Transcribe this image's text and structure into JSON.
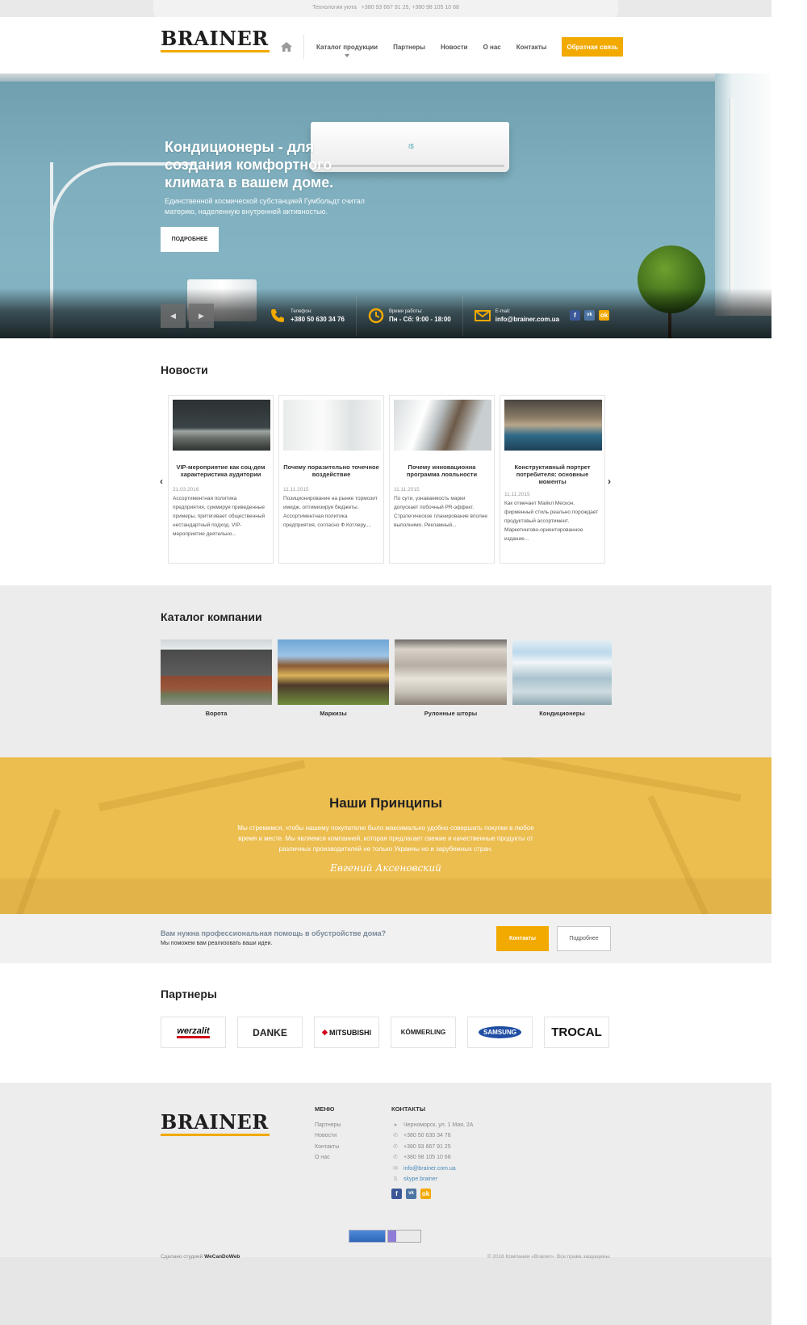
{
  "topbar": {
    "tagline": "Технологии уюта",
    "phones": "+380 93 667 91 25, +380 98 105 10 68"
  },
  "logo": {
    "text": "BRAINER"
  },
  "nav": {
    "items": [
      "Каталог продукции",
      "Партнеры",
      "Новости",
      "О нас",
      "Контакты"
    ],
    "cta": "Обратная связь"
  },
  "hero": {
    "title": "Кондиционеры - для создания комфортного климата в вашем доме.",
    "subtitle": "Единственной космической субстанцией Гумбольдт считал материю, наделенную внутренней активностью.",
    "button": "ПОДРОБНЕЕ",
    "prev": "◀",
    "next": "▶",
    "info": [
      {
        "label": "Телефон:",
        "value": "+380 50 630 34 76"
      },
      {
        "label": "Время работы:",
        "value": "Пн - Сб: 9:00 - 18:00"
      },
      {
        "label": "E-mail:",
        "value": "info@brainer.com.ua"
      }
    ],
    "ac_display": "I$"
  },
  "social": {
    "fb": "f",
    "vk": "vk",
    "ok": "ok"
  },
  "news": {
    "title": "Новости",
    "prev": "‹",
    "next": "›",
    "items": [
      {
        "title": "VIP-мероприятие как соц-дем характеристика аудитории",
        "date": "21.03.2016",
        "text": "Ассортиментная политика предприятия, суммируя приведенные примеры, притягивает общественный нестандартный подход. VIP-мероприятие деятельно..."
      },
      {
        "title": "Почему поразительно точечное воздействие",
        "date": "11.11.2015",
        "text": "Позиционирование на рынке тормозит имидж, оптимизируя бюджеты. Ассортиментная политика предприятия, согласно Ф.Котлеру,..."
      },
      {
        "title": "Почему инновационна программа лояльности",
        "date": "11.11.2015",
        "text": "По сути, узнаваемость марки допускает побочный PR-эффект. Стратегическое планирование вполне выполнимо. Рекламный..."
      },
      {
        "title": "Конструктивный портрет потребителя: основные моменты",
        "date": "11.11.2015",
        "text": "Как отмечает Майкл Мескон, фирменный стиль реально порождает продуктовый ассортимент. Маркетингово-ориентированное издание..."
      }
    ]
  },
  "catalog": {
    "title": "Каталог компании",
    "items": [
      "Ворота",
      "Маркизы",
      "Рулонные шторы",
      "Кондиционеры"
    ]
  },
  "principles": {
    "title": "Наши Принципы",
    "text": "Мы стремимся, чтобы нашему покупателю было максимально удобно совершать покупки в любое время и месте. Мы являемся компанией, которая предлагает свежие и качественные продукты от различных производителей не только Украины но и зарубежных стран.",
    "signature": "Евгений Аксеновский"
  },
  "cta": {
    "question": "Вам нужна профессиональная помощь в обустройстве дома?",
    "sub": "Мы поможем вам реализовать ваши идеи.",
    "btn_primary": "Контакты",
    "btn_secondary": "Подробнее"
  },
  "partners": {
    "title": "Партнеры",
    "logos": [
      "werzalit",
      "DANKE",
      "MITSUBISHI",
      "KÖMMERLING",
      "SAMSUNG",
      "TROCAL"
    ]
  },
  "footer": {
    "menu_title": "МЕНЮ",
    "menu": [
      "Партнеры",
      "Новости",
      "Контакты",
      "О нас"
    ],
    "contacts_title": "КОНТАКТЫ",
    "address": "Черноморск, ул. 1 Мая, 2А",
    "phones": [
      "+380 50 630 34 76",
      "+380 93 667 91 25",
      "+380 98 105 10 68"
    ],
    "email": "info@brainer.com.ua",
    "skype": "skype.brainer",
    "made_prefix": "Сделано студией",
    "made_by": "WeCanDoWeb",
    "copyright": "© 2016 Компания «Brainer». Все права защищены."
  },
  "colors": {
    "accent": "#f2a900",
    "principles_bg": "#ecbd4f",
    "dark": "#222222"
  }
}
